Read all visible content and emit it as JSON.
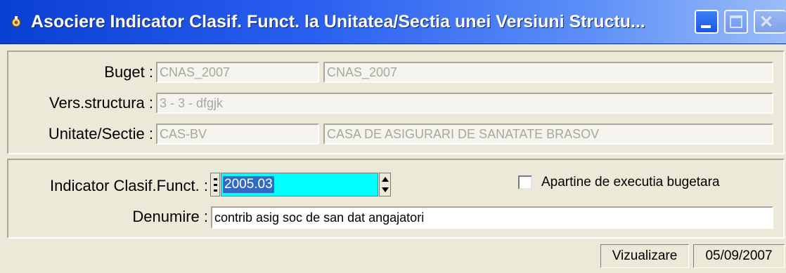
{
  "window": {
    "title": "Asociere Indicator Clasif. Funct. la Unitatea/Sectia unei Versiuni Structu...",
    "icon": "app-icon",
    "controls": [
      "minimize-icon",
      "maximize-icon",
      "close-icon"
    ]
  },
  "group1": {
    "buget": {
      "label": "Buget :",
      "code": "CNAS_2007",
      "name": "CNAS_2007"
    },
    "versiune": {
      "label": "Vers.structura :",
      "value": "3 - 3 - dfgjk"
    },
    "unitate": {
      "label": "Unitate/Sectie :",
      "code": "CAS-BV",
      "name": "CASA DE ASIGURARI DE SANATATE BRASOV"
    }
  },
  "group2": {
    "indicator": {
      "label": "Indicator Clasif.Funct. :",
      "value": "2005.03"
    },
    "checkbox": {
      "label": "Apartine de executia bugetara",
      "checked": false
    },
    "denumire": {
      "label": "Denumire :",
      "value": "contrib asig soc de san dat angajatori"
    }
  },
  "status": {
    "mode": "Vizualizare",
    "date": "05/09/2007"
  },
  "colors": {
    "titlebar": "#0a3fd3",
    "face": "#ece9d8",
    "highlight_field": "#00ffff",
    "selection": "#316ac5"
  }
}
